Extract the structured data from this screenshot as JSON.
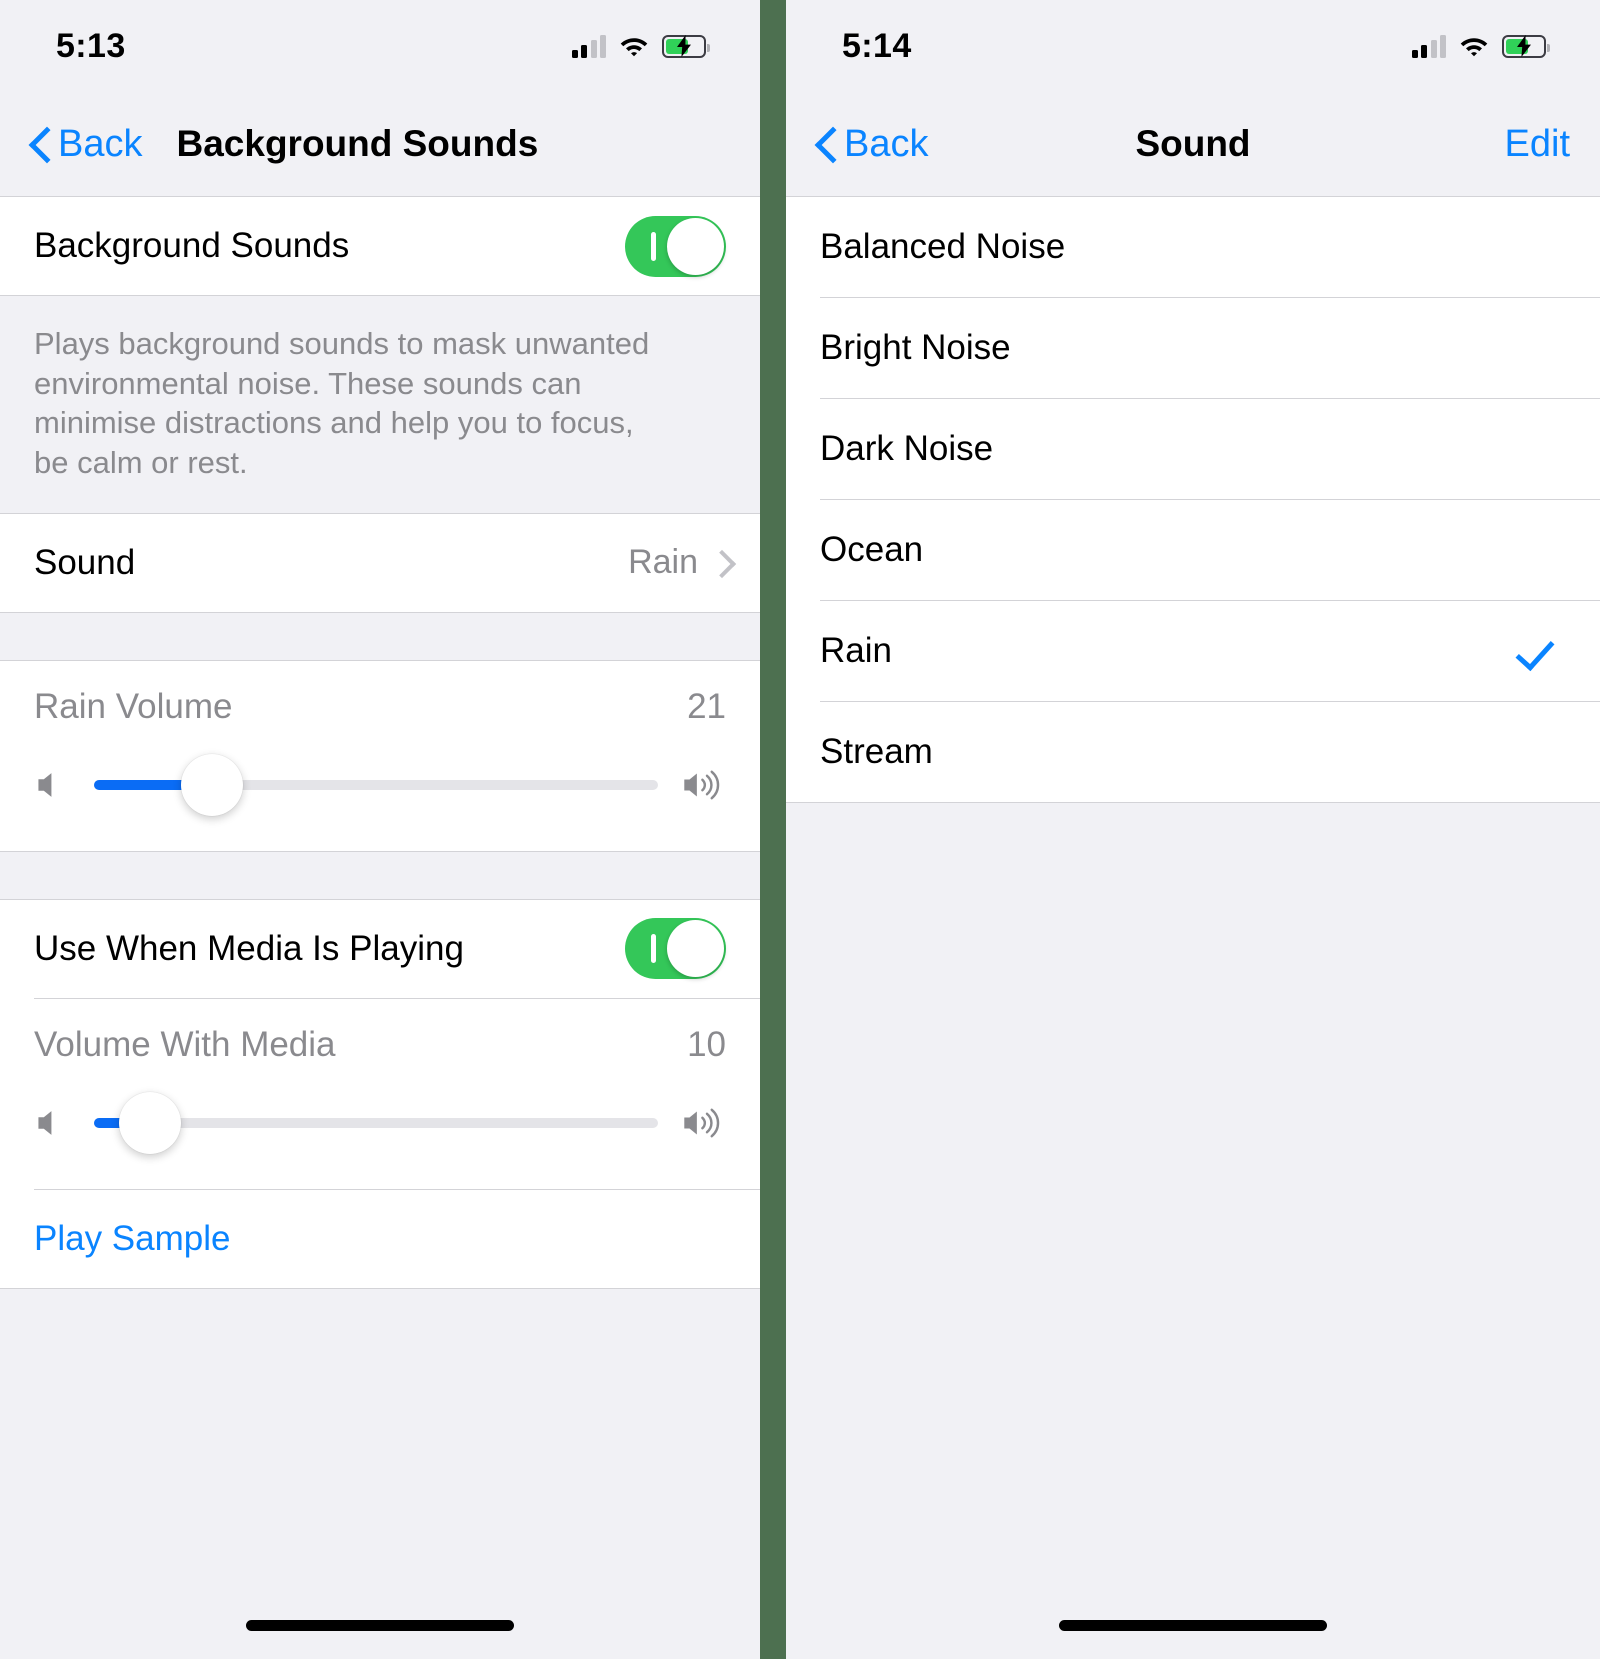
{
  "theme": {
    "accent_blue": "#0a84ff",
    "slider_blue": "#0a6cf5",
    "toggle_green": "#34c759",
    "divider_green": "#4d7050",
    "group_bg": "#f1f1f5",
    "secondary_text": "#8a8a8e"
  },
  "left": {
    "status": {
      "time": "5:13",
      "signal": "signal-bars-2-of-4",
      "wifi": "wifi-full",
      "battery": "battery-charging"
    },
    "nav": {
      "back_label": "Back",
      "title": "Background Sounds"
    },
    "toggle_row": {
      "label": "Background Sounds",
      "value": "on"
    },
    "description": "Plays background sounds to mask unwanted environmental noise. These sounds can minimise distractions and help you to focus, be calm or rest.",
    "sound_row": {
      "label": "Sound",
      "value": "Rain"
    },
    "rain_volume": {
      "label": "Rain Volume",
      "value": "21",
      "percent": 21,
      "min_icon": "speaker-low-icon",
      "max_icon": "speaker-high-icon"
    },
    "media_toggle_row": {
      "label": "Use When Media Is Playing",
      "value": "on"
    },
    "media_volume": {
      "label": "Volume With Media",
      "value": "10",
      "percent": 10,
      "min_icon": "speaker-low-icon",
      "max_icon": "speaker-high-icon"
    },
    "play_sample": {
      "label": "Play Sample"
    }
  },
  "right": {
    "status": {
      "time": "5:14",
      "signal": "signal-bars-2-of-4",
      "wifi": "wifi-full",
      "battery": "battery-charging"
    },
    "nav": {
      "back_label": "Back",
      "title": "Sound",
      "edit_label": "Edit"
    },
    "sounds": [
      {
        "label": "Balanced Noise",
        "selected": false
      },
      {
        "label": "Bright Noise",
        "selected": false
      },
      {
        "label": "Dark Noise",
        "selected": false
      },
      {
        "label": "Ocean",
        "selected": false
      },
      {
        "label": "Rain",
        "selected": true
      },
      {
        "label": "Stream",
        "selected": false
      }
    ]
  }
}
